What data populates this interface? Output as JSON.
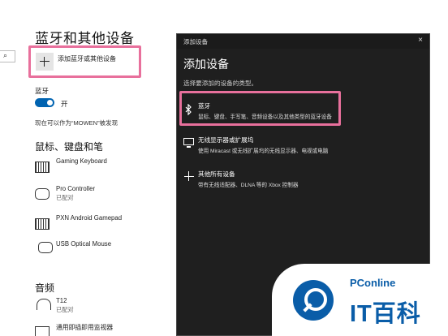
{
  "settings": {
    "search_icon": "⌕",
    "title": "蓝牙和其他设备",
    "add_device_label": "添加蓝牙或其他设备",
    "bluetooth_label": "蓝牙",
    "bluetooth_state": "开",
    "discoverable_text": "现在可以作为“MOWEN”被发现",
    "section_keyboard_mouse": "鼠标、键盘和笔",
    "devices": [
      {
        "name": "Gaming Keyboard",
        "status": "",
        "icon": "keyboard-icon"
      },
      {
        "name": "Pro Controller",
        "status": "已配对",
        "icon": "gamepad-icon"
      },
      {
        "name": "PXN Android Gamepad",
        "status": "",
        "icon": "keyboard-icon"
      },
      {
        "name": "USB Optical Mouse",
        "status": "",
        "icon": "mouse-icon"
      }
    ],
    "section_audio": "音频",
    "audio_devices": [
      {
        "name": "T12",
        "status": "已配对",
        "icon": "headset-icon"
      },
      {
        "name": "通用即插即用监视器",
        "status": "",
        "icon": "monitor-icon"
      }
    ]
  },
  "dialog": {
    "bar_title": "添加设备",
    "close_glyph": "×",
    "heading": "添加设备",
    "subtitle": "选择要添加的设备的类型。",
    "options": [
      {
        "title": "蓝牙",
        "desc": "鼠标、键盘、手写笔、音频设备以及其他类型的蓝牙设备",
        "icon": "bluetooth-icon"
      },
      {
        "title": "无线显示器或扩展坞",
        "desc": "使用 Miracast 或无线扩展坞的无线显示器、电视或电脑",
        "icon": "monitor-icon"
      },
      {
        "title": "其他所有设备",
        "desc": "带有无线适配器、DLNA 等的 Xbox 控制器",
        "icon": "plus-icon"
      }
    ]
  },
  "watermark": {
    "small": "PConline",
    "big": "IT百科"
  },
  "colors": {
    "accent_blue": "#0063b1",
    "highlight_pink": "#e8709c",
    "dialog_bg": "#1f1f1f",
    "watermark_blue": "#0a5da8"
  }
}
